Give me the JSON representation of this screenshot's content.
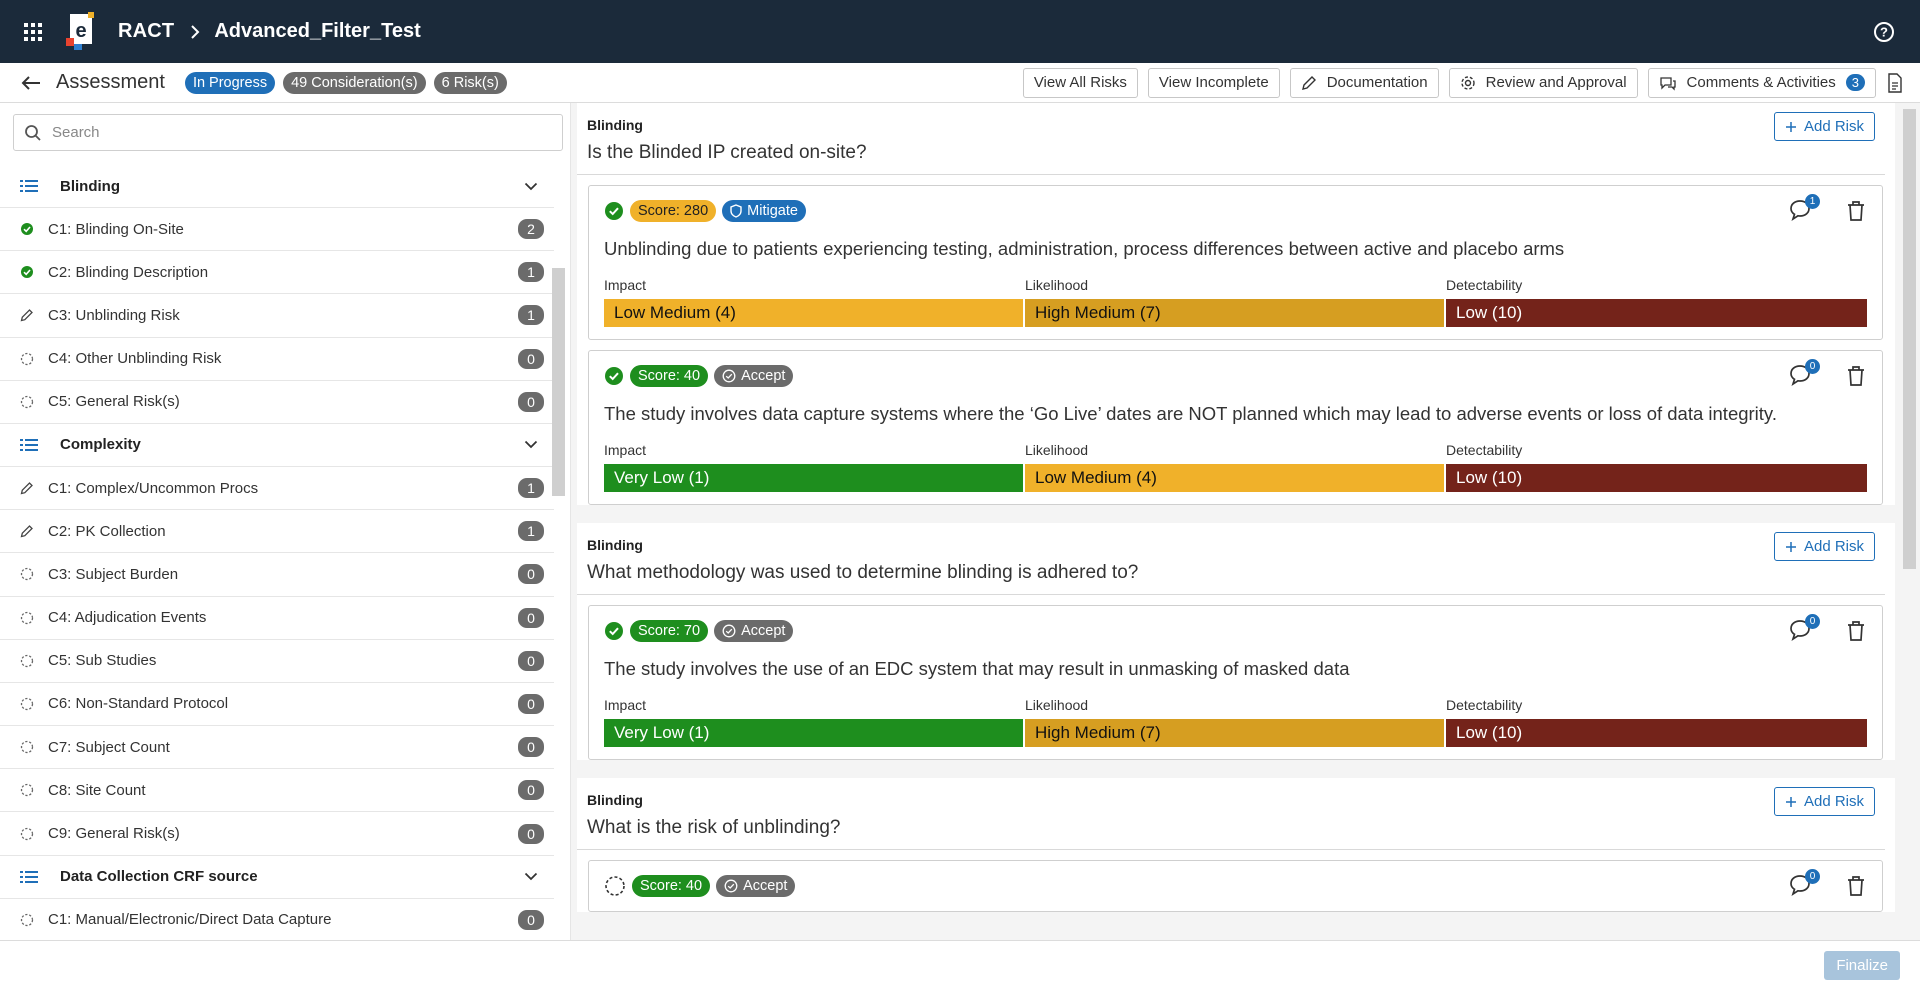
{
  "topbar": {
    "app_name": "RACT",
    "project_name": "Advanced_Filter_Test"
  },
  "subheader": {
    "title": "Assessment",
    "status": "In Progress",
    "considerations": "49 Consideration(s)",
    "risks": "6 Risk(s)",
    "buttons": {
      "view_all": "View All Risks",
      "view_incomplete": "View Incomplete",
      "documentation": "Documentation",
      "review": "Review and Approval",
      "comments": "Comments & Activities",
      "comments_count": "3"
    }
  },
  "sidebar": {
    "search_placeholder": "Search",
    "groups": [
      {
        "name": "Blinding",
        "items": [
          {
            "label": "C1: Blinding On-Site",
            "count": "2",
            "status": "complete"
          },
          {
            "label": "C2: Blinding Description",
            "count": "1",
            "status": "complete"
          },
          {
            "label": "C3: Unblinding Risk",
            "count": "1",
            "status": "edit"
          },
          {
            "label": "C4: Other Unblinding Risk",
            "count": "0",
            "status": "pending"
          },
          {
            "label": "C5: General Risk(s)",
            "count": "0",
            "status": "pending"
          }
        ]
      },
      {
        "name": "Complexity",
        "items": [
          {
            "label": "C1: Complex/Uncommon Procs",
            "count": "1",
            "status": "edit"
          },
          {
            "label": "C2: PK Collection",
            "count": "1",
            "status": "edit"
          },
          {
            "label": "C3: Subject Burden",
            "count": "0",
            "status": "pending"
          },
          {
            "label": "C4: Adjudication Events",
            "count": "0",
            "status": "pending"
          },
          {
            "label": "C5: Sub Studies",
            "count": "0",
            "status": "pending"
          },
          {
            "label": "C6: Non-Standard Protocol",
            "count": "0",
            "status": "pending"
          },
          {
            "label": "C7: Subject Count",
            "count": "0",
            "status": "pending"
          },
          {
            "label": "C8: Site Count",
            "count": "0",
            "status": "pending"
          },
          {
            "label": "C9: General Risk(s)",
            "count": "0",
            "status": "pending"
          }
        ]
      },
      {
        "name": "Data Collection CRF source",
        "items": [
          {
            "label": "C1: Manual/Electronic/Direct Data Capture",
            "count": "0",
            "status": "pending"
          }
        ]
      }
    ]
  },
  "content": {
    "add_risk_label": "Add Risk",
    "labels": {
      "impact": "Impact",
      "likelihood": "Likelihood",
      "detectability": "Detectability"
    },
    "questions": [
      {
        "category": "Blinding",
        "question": "Is the Blinded IP created on-site?",
        "risks": [
          {
            "score": "Score: 280",
            "score_color": "orange",
            "action": "Mitigate",
            "action_type": "mitigate",
            "comments": "1",
            "done": true,
            "description": "Unblinding due to patients experiencing testing, administration, process differences between active and placebo arms",
            "impact": {
              "text": "Low Medium (4)",
              "color": "orange"
            },
            "likelihood": {
              "text": "High Medium (7)",
              "color": "gold"
            },
            "detectability": {
              "text": "Low (10)",
              "color": "darkred"
            }
          },
          {
            "score": "Score: 40",
            "score_color": "green",
            "action": "Accept",
            "action_type": "accept",
            "comments": "0",
            "done": true,
            "description": "The study involves data capture systems where the ‘Go Live’ dates are NOT planned which may lead to adverse events or loss of data integrity.",
            "impact": {
              "text": "Very Low (1)",
              "color": "green"
            },
            "likelihood": {
              "text": "Low Medium (4)",
              "color": "orange"
            },
            "detectability": {
              "text": "Low (10)",
              "color": "darkred"
            }
          }
        ]
      },
      {
        "category": "Blinding",
        "question": "What methodology was used to determine blinding is adhered to?",
        "risks": [
          {
            "score": "Score: 70",
            "score_color": "green",
            "action": "Accept",
            "action_type": "accept",
            "comments": "0",
            "done": true,
            "description": "The study involves the use of an EDC system that may result in unmasking of masked data",
            "impact": {
              "text": "Very Low (1)",
              "color": "green"
            },
            "likelihood": {
              "text": "High Medium (7)",
              "color": "gold"
            },
            "detectability": {
              "text": "Low (10)",
              "color": "darkred"
            }
          }
        ]
      },
      {
        "category": "Blinding",
        "question": "What is the risk of unblinding?",
        "risks": [
          {
            "score": "Score: 40",
            "score_color": "green",
            "action": "Accept",
            "action_type": "accept",
            "comments": "0",
            "done": false,
            "description": "",
            "impact": null,
            "likelihood": null,
            "detectability": null
          }
        ]
      }
    ]
  },
  "footer": {
    "finalize": "Finalize"
  }
}
